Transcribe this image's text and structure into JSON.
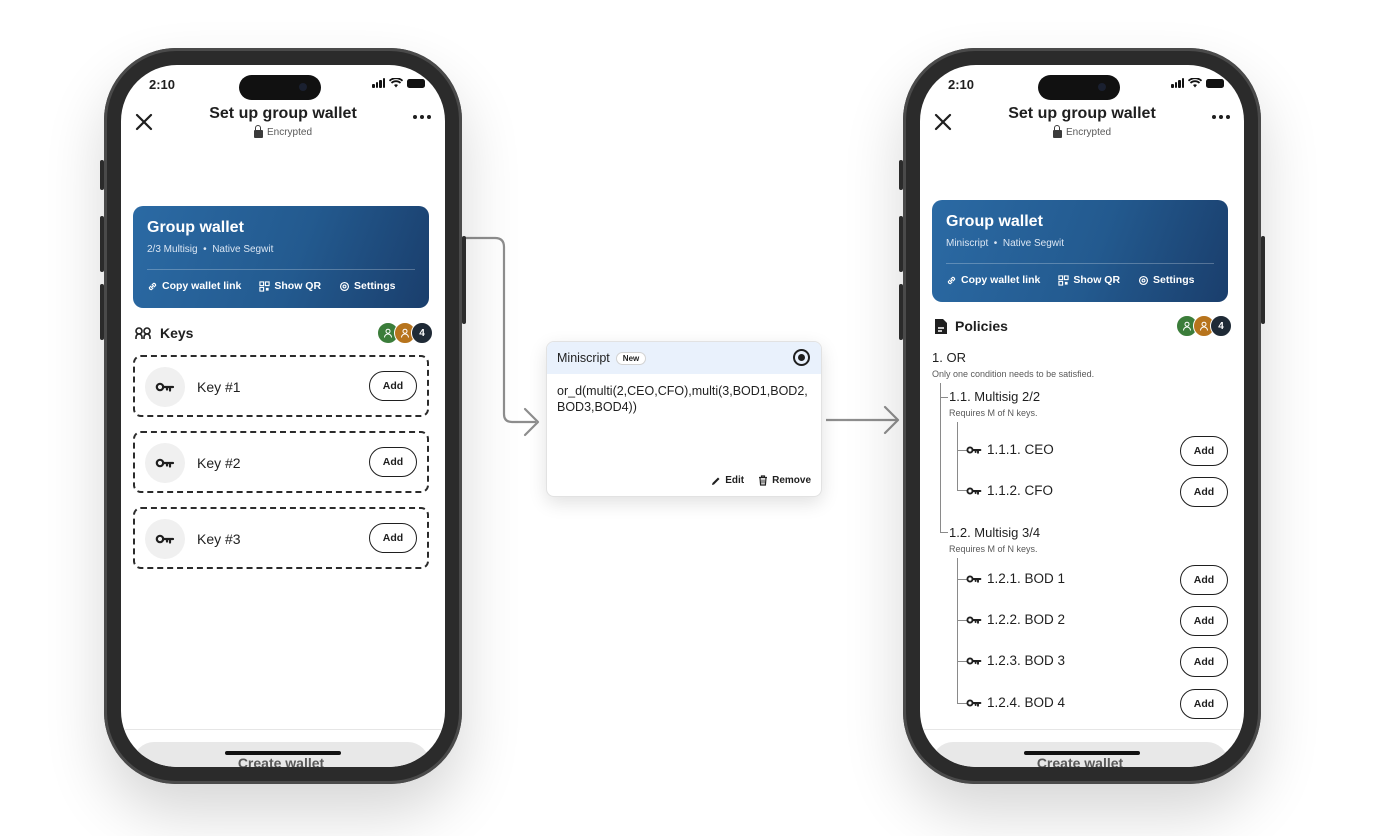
{
  "status": {
    "time": "2:10"
  },
  "nav": {
    "title": "Set up group wallet",
    "subtitle": "Encrypted"
  },
  "left_phone": {
    "wallet": {
      "name": "Group wallet",
      "type": "2/3 Multisig",
      "address_type": "Native Segwit"
    },
    "actions": {
      "copy": "Copy wallet link",
      "qr": "Show QR",
      "settings": "Settings"
    },
    "section_label": "Keys",
    "avatar_count": "4",
    "keys": [
      {
        "name": "Key #1",
        "add": "Add"
      },
      {
        "name": "Key #2",
        "add": "Add"
      },
      {
        "name": "Key #3",
        "add": "Add"
      }
    ],
    "create_label": "Create wallet"
  },
  "miniscript": {
    "title": "Miniscript",
    "badge": "New",
    "script": "or_d(multi(2,CEO,CFO),multi(3,BOD1,BOD2,BOD3,BOD4))",
    "edit_label": "Edit",
    "remove_label": "Remove"
  },
  "right_phone": {
    "wallet": {
      "name": "Group wallet",
      "type": "Miniscript",
      "address_type": "Native Segwit"
    },
    "actions": {
      "copy": "Copy wallet link",
      "qr": "Show QR",
      "settings": "Settings"
    },
    "section_label": "Policies",
    "avatar_count": "4",
    "root": {
      "title": "1. OR",
      "desc": "Only one condition needs to be satisfied."
    },
    "groups": [
      {
        "title": "1.1. Multisig 2/2",
        "desc": "Requires M of N keys.",
        "keys": [
          {
            "label": "1.1.1. CEO",
            "add": "Add"
          },
          {
            "label": "1.1.2. CFO",
            "add": "Add"
          }
        ]
      },
      {
        "title": "1.2. Multisig 3/4",
        "desc": "Requires M of N keys.",
        "keys": [
          {
            "label": "1.2.1. BOD 1",
            "add": "Add"
          },
          {
            "label": "1.2.2. BOD 2",
            "add": "Add"
          },
          {
            "label": "1.2.3. BOD 3",
            "add": "Add"
          },
          {
            "label": "1.2.4. BOD 4",
            "add": "Add"
          }
        ]
      }
    ],
    "create_label": "Create wallet"
  },
  "colors": {
    "card_blue": "#235a8f",
    "avatar_green": "#3b7d3a",
    "avatar_orange": "#b7741d",
    "avatar_dark": "#1f2a36",
    "highlight": "#e9f1fc"
  }
}
